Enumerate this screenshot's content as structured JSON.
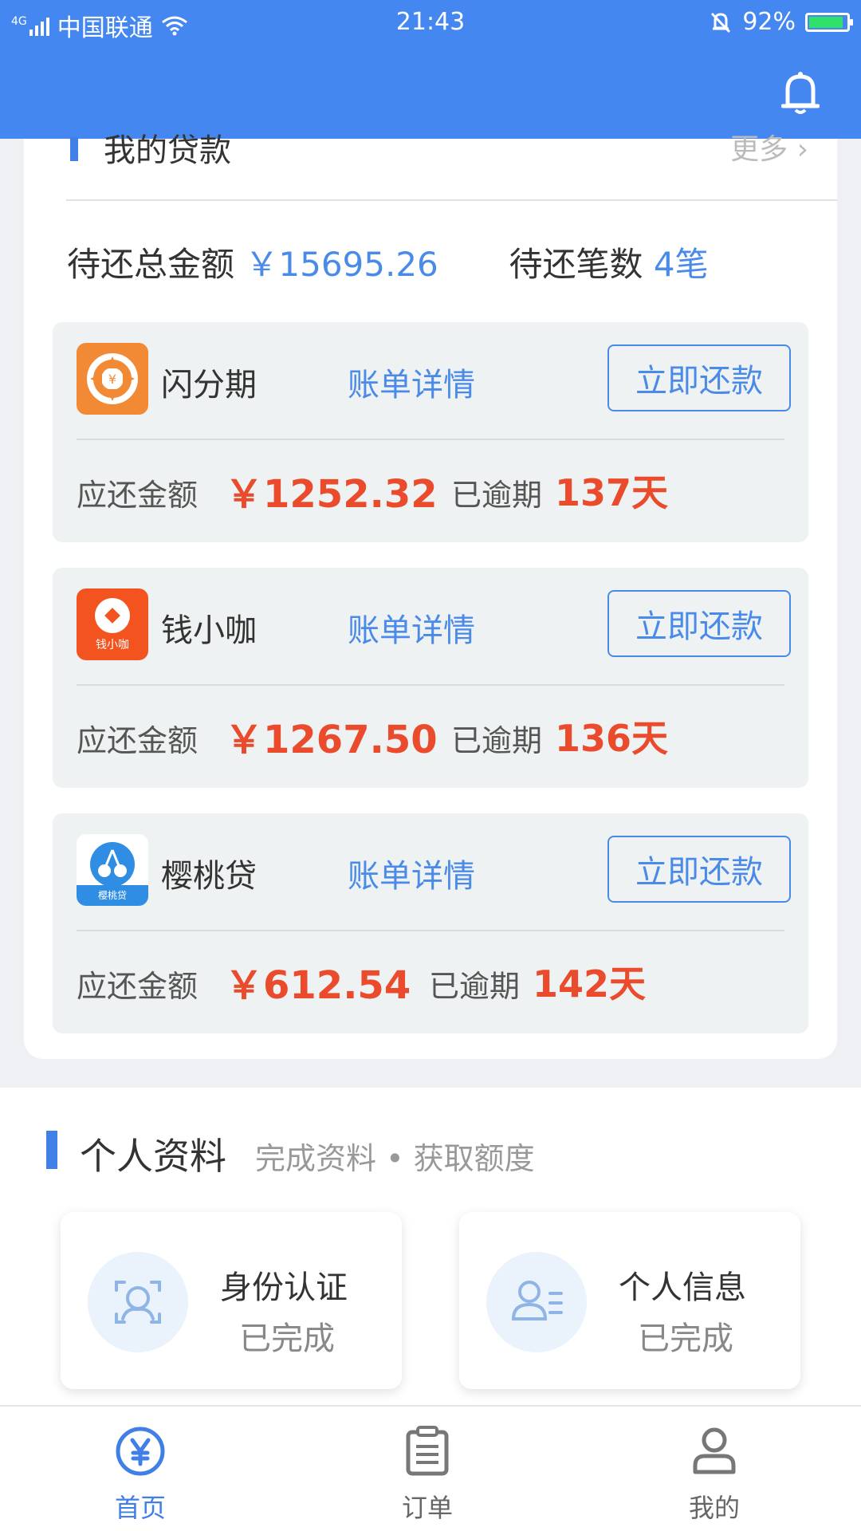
{
  "status_bar": {
    "network": "4G",
    "carrier": "中国联通",
    "time": "21:43",
    "battery": "92%",
    "battery_level": 0.92
  },
  "loans": {
    "title": "我的贷款",
    "more_label": "更多",
    "summary": {
      "total_label": "待还总金额",
      "total_value": "￥15695.26",
      "count_label": "待还笔数",
      "count_value": "4笔"
    },
    "items": [
      {
        "name": "闪分期",
        "detail_label": "账单详情",
        "repay_label": "立即还款",
        "amount_label": "应还金额",
        "amount": "￥1252.32",
        "overdue_label": "已逾期",
        "overdue_days": "137天",
        "logo_color": "#f28a35"
      },
      {
        "name": "钱小咖",
        "detail_label": "账单详情",
        "repay_label": "立即还款",
        "amount_label": "应还金额",
        "amount": "￥1267.50",
        "overdue_label": "已逾期",
        "overdue_days": "136天",
        "logo_text": "钱小咖",
        "logo_color": "#f2531f"
      },
      {
        "name": "樱桃贷",
        "detail_label": "账单详情",
        "repay_label": "立即还款",
        "amount_label": "应还金额",
        "amount": "￥612.54",
        "overdue_label": "已逾期",
        "overdue_days": "142天",
        "logo_text": "樱桃贷",
        "logo_color": "#2f8de4"
      }
    ]
  },
  "personal": {
    "title": "个人资料",
    "subtitle": "完成资料 • 获取额度",
    "cards": [
      {
        "title": "身份认证",
        "status": "已完成",
        "icon": "face-id-icon"
      },
      {
        "title": "个人信息",
        "status": "已完成",
        "icon": "user-info-icon"
      }
    ]
  },
  "tabbar": {
    "tabs": [
      {
        "label": "首页",
        "icon": "yen-circle-icon",
        "active": true
      },
      {
        "label": "订单",
        "icon": "clipboard-icon",
        "active": false
      },
      {
        "label": "我的",
        "icon": "person-icon",
        "active": false
      }
    ]
  },
  "colors": {
    "primary": "#4487f0",
    "link": "#4a8ae8",
    "danger": "#ea4b2c"
  }
}
